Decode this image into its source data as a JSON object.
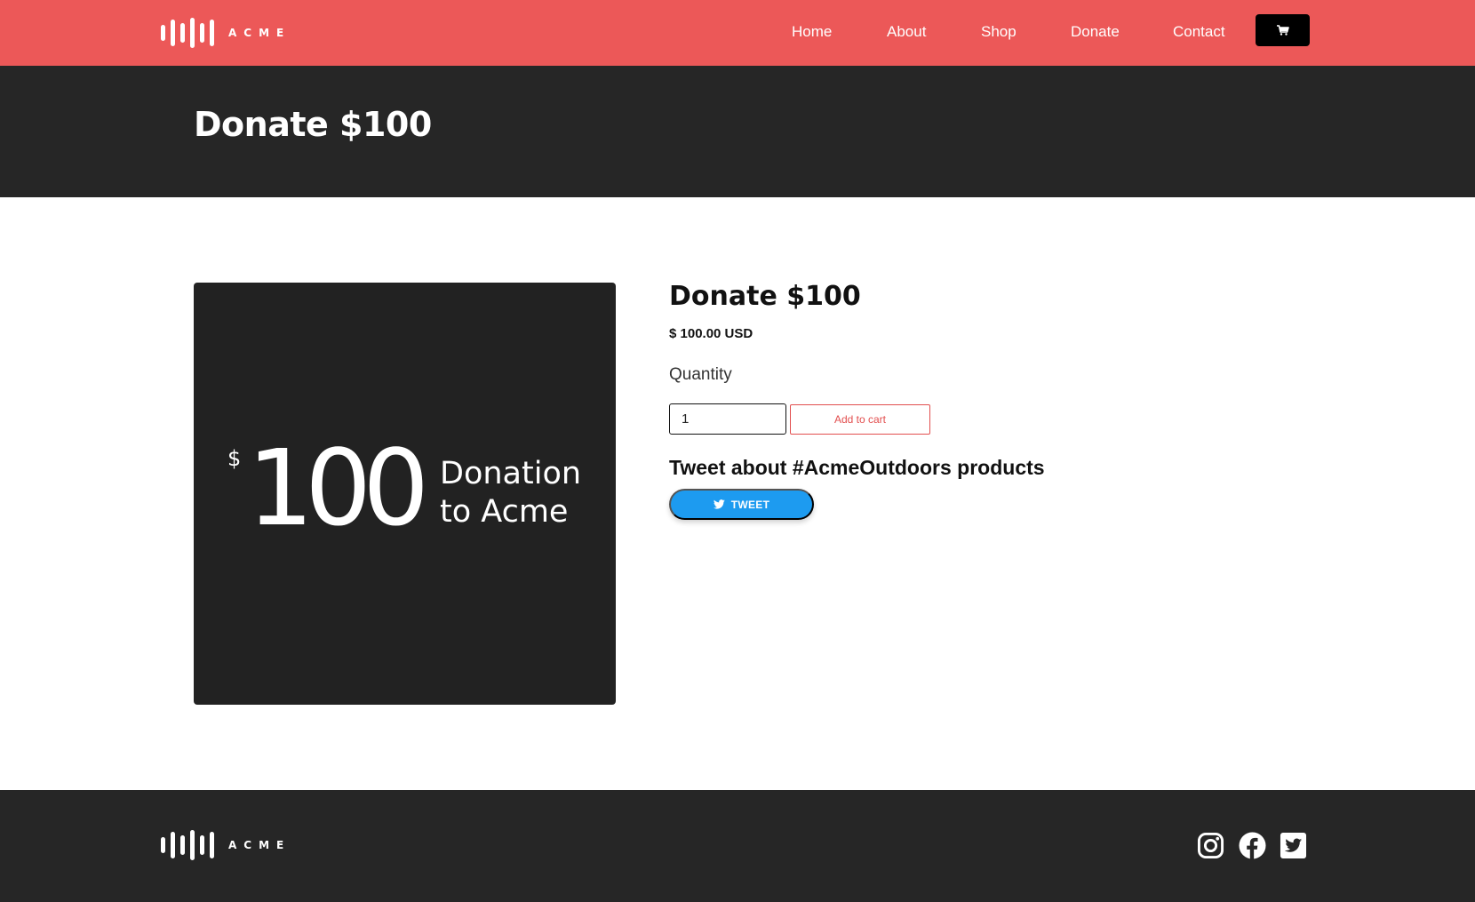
{
  "brand": {
    "logo_text": "ACME",
    "accent_color": "#ec5858",
    "dark_color": "#262626"
  },
  "nav": {
    "items": [
      {
        "label": "Home"
      },
      {
        "label": "About"
      },
      {
        "label": "Shop"
      },
      {
        "label": "Donate"
      },
      {
        "label": "Contact"
      }
    ],
    "cart_icon": "shopping-cart-icon"
  },
  "hero": {
    "title": "Donate $100"
  },
  "product": {
    "image": {
      "currency": "$",
      "amount": "100",
      "line1": "Donation",
      "line2": "to Acme"
    },
    "title": "Donate $100",
    "price": "$ 100.00 USD",
    "quantity_label": "Quantity",
    "quantity_value": "1",
    "add_to_cart_label": "Add to cart",
    "tweet_heading": "Tweet about #AcmeOutdoors products",
    "tweet_button_label": "TWEET",
    "tweet_button_color": "#1d9bf0"
  },
  "footer": {
    "logo_text": "ACME",
    "social": [
      {
        "icon": "instagram-icon"
      },
      {
        "icon": "facebook-icon"
      },
      {
        "icon": "twitter-icon"
      }
    ]
  }
}
